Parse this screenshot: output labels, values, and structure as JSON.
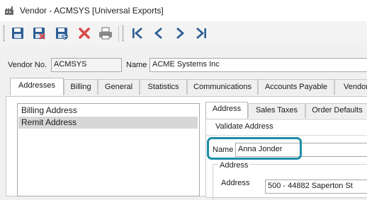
{
  "window": {
    "title": "Vendor - ACMSYS [Universal Exports]"
  },
  "toolbar": {
    "buttons": [
      {
        "icon": "save-icon"
      },
      {
        "icon": "save-and-close-icon"
      },
      {
        "icon": "save-and-new-icon"
      },
      {
        "icon": "delete-icon"
      },
      {
        "icon": "print-icon"
      },
      {
        "icon": "first-record-icon"
      },
      {
        "icon": "previous-record-icon"
      },
      {
        "icon": "next-record-icon"
      },
      {
        "icon": "last-record-icon"
      }
    ]
  },
  "header": {
    "vendor_no_label": "Vendor No.",
    "vendor_no_value": "ACMSYS",
    "name_label": "Name",
    "name_value": "ACME Systems Inc"
  },
  "tabs": [
    "Addresses",
    "Billing",
    "General",
    "Statistics",
    "Communications",
    "Accounts Payable",
    "Vendor"
  ],
  "addresses": {
    "items": [
      "Billing Address",
      "Remit Address"
    ],
    "selected": "Remit Address"
  },
  "detail": {
    "tabs": [
      "Address",
      "Sales Taxes",
      "Order Defaults"
    ],
    "validate_label": "Validate Address",
    "name_label": "Name",
    "name_value": "Anna Jonder",
    "address_group_label": "Address",
    "address_label": "Address",
    "address_value": "500 - 44882 Saperton St"
  },
  "colors": {
    "highlight": "#1d8da7",
    "toolbar_icon": "#2f5f95",
    "delete_icon": "#d94a4a",
    "selected_row": "#d7d7d7"
  }
}
